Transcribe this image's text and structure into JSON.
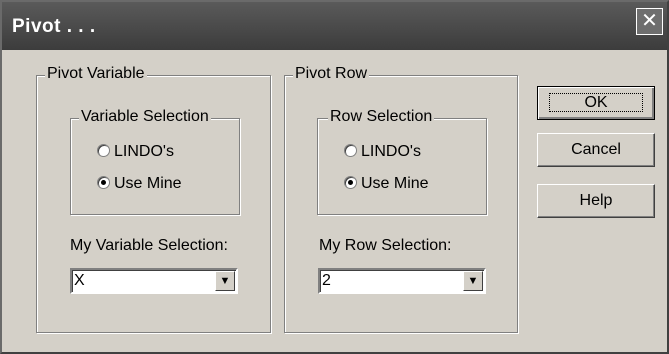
{
  "window": {
    "title": "Pivot . . .",
    "close_glyph": "✕"
  },
  "pivot_variable": {
    "legend": "Pivot Variable",
    "selection_legend": "Variable Selection",
    "options": [
      "LINDO's",
      "Use Mine"
    ],
    "selected": "Use Mine",
    "field_label": "My Variable Selection:",
    "field_value": "X"
  },
  "pivot_row": {
    "legend": "Pivot Row",
    "selection_legend": "Row Selection",
    "options": [
      "LINDO's",
      "Use Mine"
    ],
    "selected": "Use Mine",
    "field_label": "My Row Selection:",
    "field_value": "2"
  },
  "buttons": {
    "ok": "OK",
    "cancel": "Cancel",
    "help": "Help"
  },
  "icons": {
    "dropdown": "▼"
  }
}
